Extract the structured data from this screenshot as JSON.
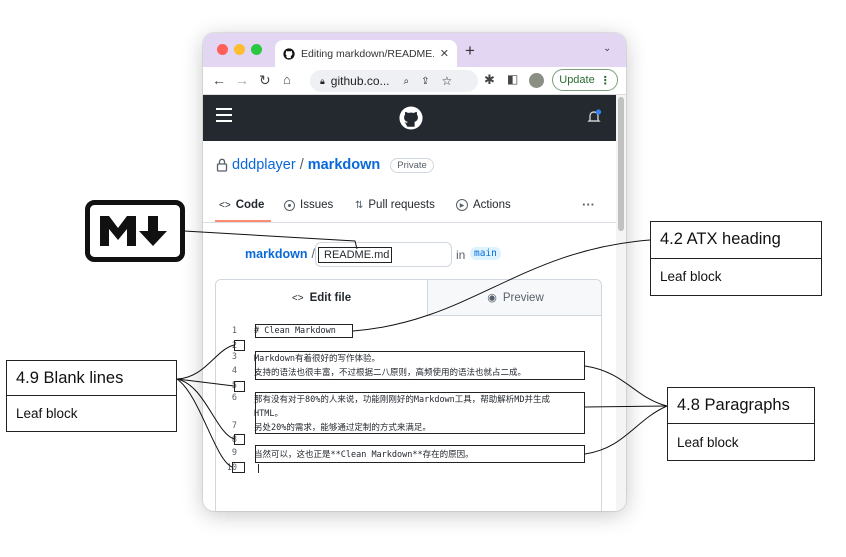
{
  "browser": {
    "tab_title": "Editing markdown/README.md",
    "new_tab": "+",
    "address": "github.co...",
    "update_label": "Update",
    "colors": {
      "tabstrip": "#e3d6f3",
      "close": "#ff5f57",
      "min": "#febc2e",
      "max": "#28c840"
    }
  },
  "github": {
    "owner": "dddplayer",
    "separator": "/",
    "repo": "markdown",
    "visibility": "Private",
    "nav": [
      {
        "label": "Code",
        "icon": "code-icon"
      },
      {
        "label": "Issues",
        "icon": "issue-icon"
      },
      {
        "label": "Pull requests",
        "icon": "pull-request-icon"
      },
      {
        "label": "Actions",
        "icon": "actions-icon"
      }
    ],
    "more": "···",
    "path_repo": "markdown",
    "path_sep": "/",
    "filename": "README.md",
    "in_label": "in",
    "branch": "main",
    "edit_tab": "Edit file",
    "preview_tab": "Preview"
  },
  "editor": {
    "lines": [
      {
        "n": "1",
        "text": "# Clean Markdown"
      },
      {
        "n": "2",
        "text": ""
      },
      {
        "n": "3",
        "text": "Markdown有着很好的写作体验。"
      },
      {
        "n": "4",
        "text": "支持的语法也很丰富，不过根据二八原则，高频使用的语法也就占二成。"
      },
      {
        "n": "5",
        "text": ""
      },
      {
        "n": "6",
        "text": "那有没有对于80%的人来说，功能刚刚好的Markdown工具，帮助解析MD并生成"
      },
      {
        "n": "",
        "text": "HTML。"
      },
      {
        "n": "7",
        "text": "另处20%的需求，能够通过定制的方式来满足。"
      },
      {
        "n": "8",
        "text": ""
      },
      {
        "n": "9",
        "text": "当然可以，这也正是**Clean Markdown**存在的原因。"
      },
      {
        "n": "10",
        "text": ""
      }
    ]
  },
  "annotations": {
    "atx": {
      "title": "4.2 ATX heading",
      "sub": "Leaf block"
    },
    "blank": {
      "title": "4.9 Blank lines",
      "sub": "Leaf block"
    },
    "para": {
      "title": "4.8 Paragraphs",
      "sub": "Leaf block"
    }
  }
}
